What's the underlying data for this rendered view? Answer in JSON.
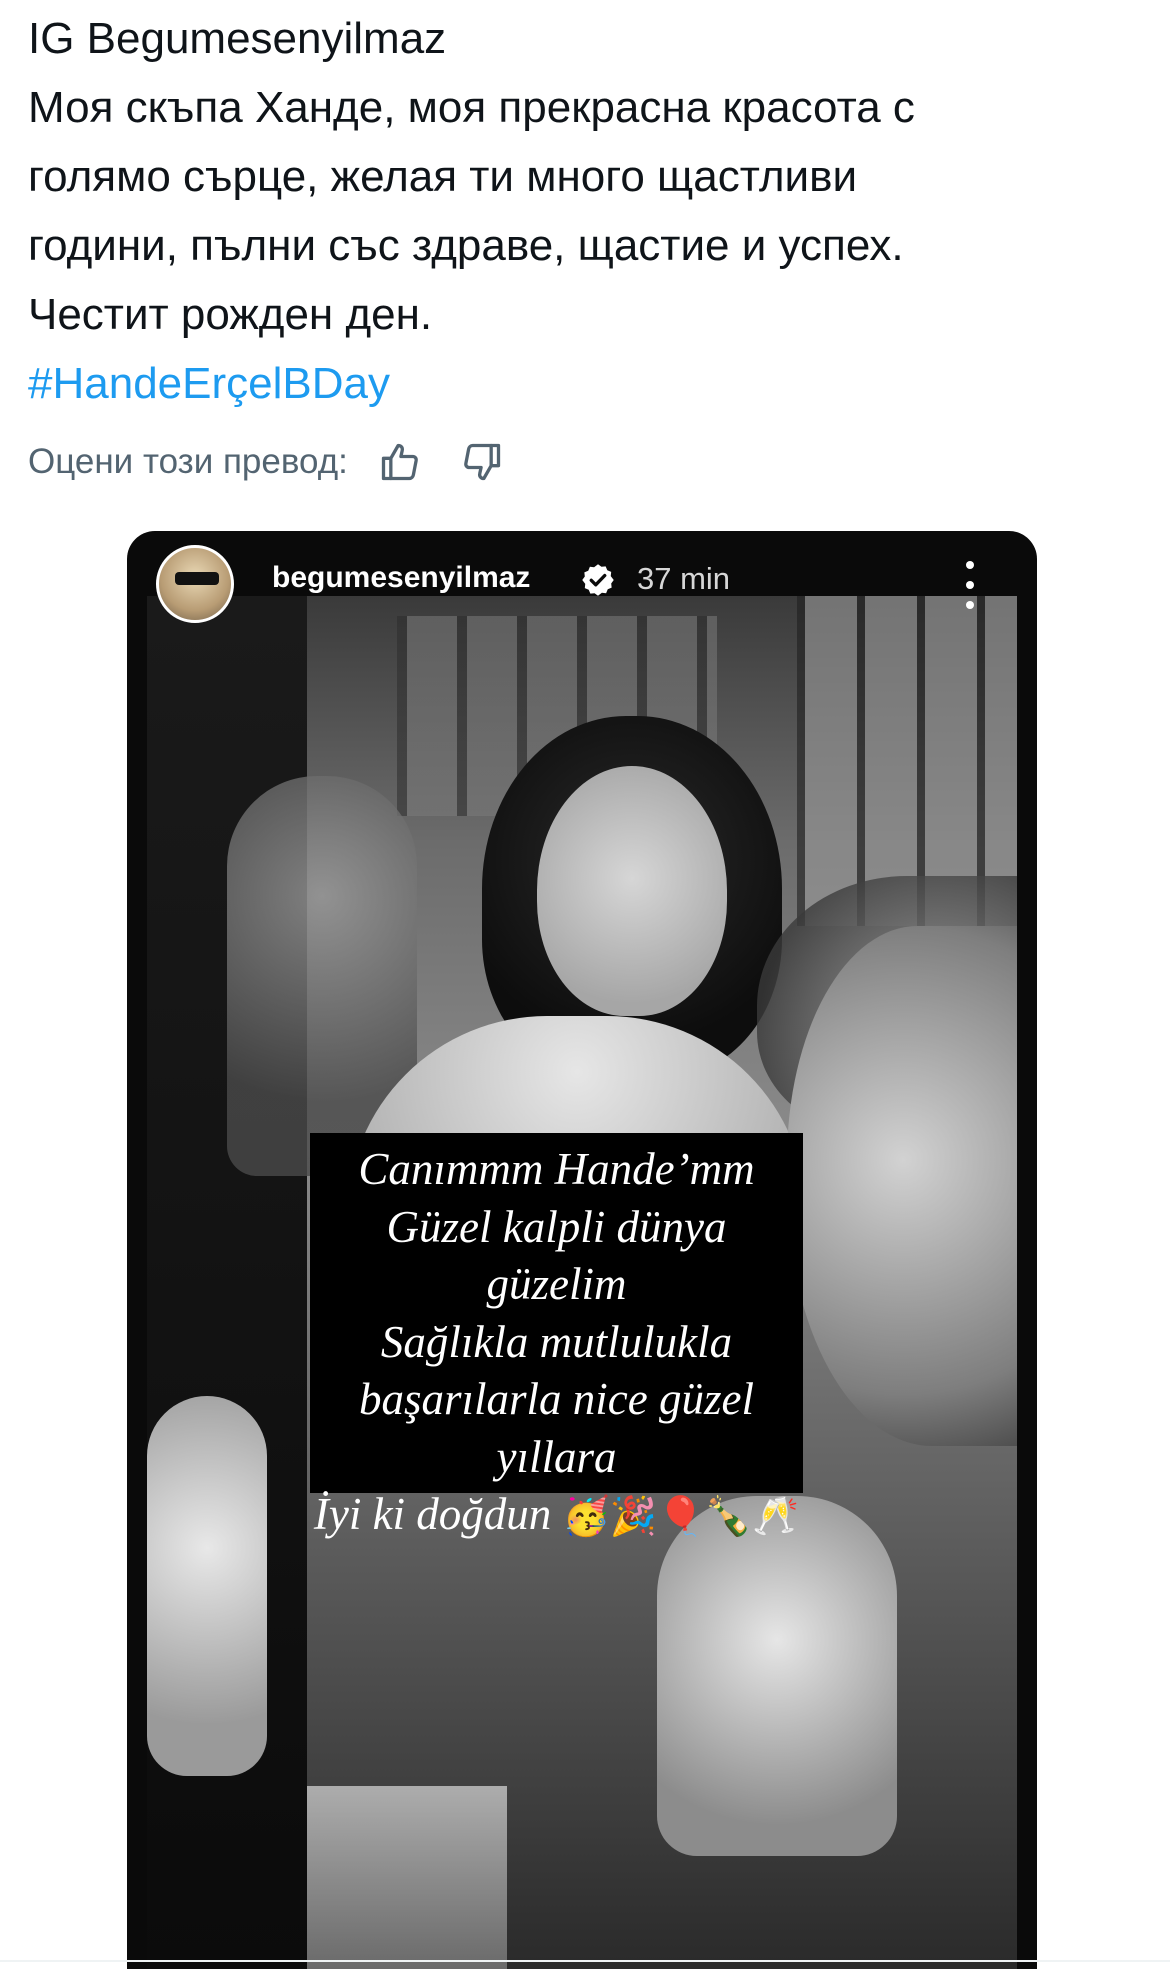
{
  "tweet": {
    "lines": [
      "IG Begumesenyilmaz",
      "Моя скъпа Ханде, моя прекрасна красота с",
      "голямо сърце, желая ти много щастливи",
      "години, пълни със здраве, щастие и успех.",
      "Честит рожден ден."
    ],
    "hashtag": "#HandeErçelBDay"
  },
  "translation_rating": {
    "label": "Оцени този превод:",
    "thumbs_up_icon": "thumbs-up-icon",
    "thumbs_down_icon": "thumbs-down-icon"
  },
  "story": {
    "username": "begumesenyilmaz",
    "verified_icon": "verified-badge-icon",
    "time": "37 min",
    "more_icon": "more-vertical-icon",
    "caption_lines": [
      "Canımmm Hande’mm",
      "Güzel kalpli dünya",
      "güzelim",
      "Sağlıkla mutlulukla",
      "başarılarla nice güzel",
      "yıllara",
      "İyi ki doğdun"
    ],
    "caption_emojis": "🥳🎉🎈🍾🥂"
  },
  "colors": {
    "text": "#0f1419",
    "secondary": "#536471",
    "link": "#1d9bf0",
    "story_bg": "#0a0a0a"
  }
}
